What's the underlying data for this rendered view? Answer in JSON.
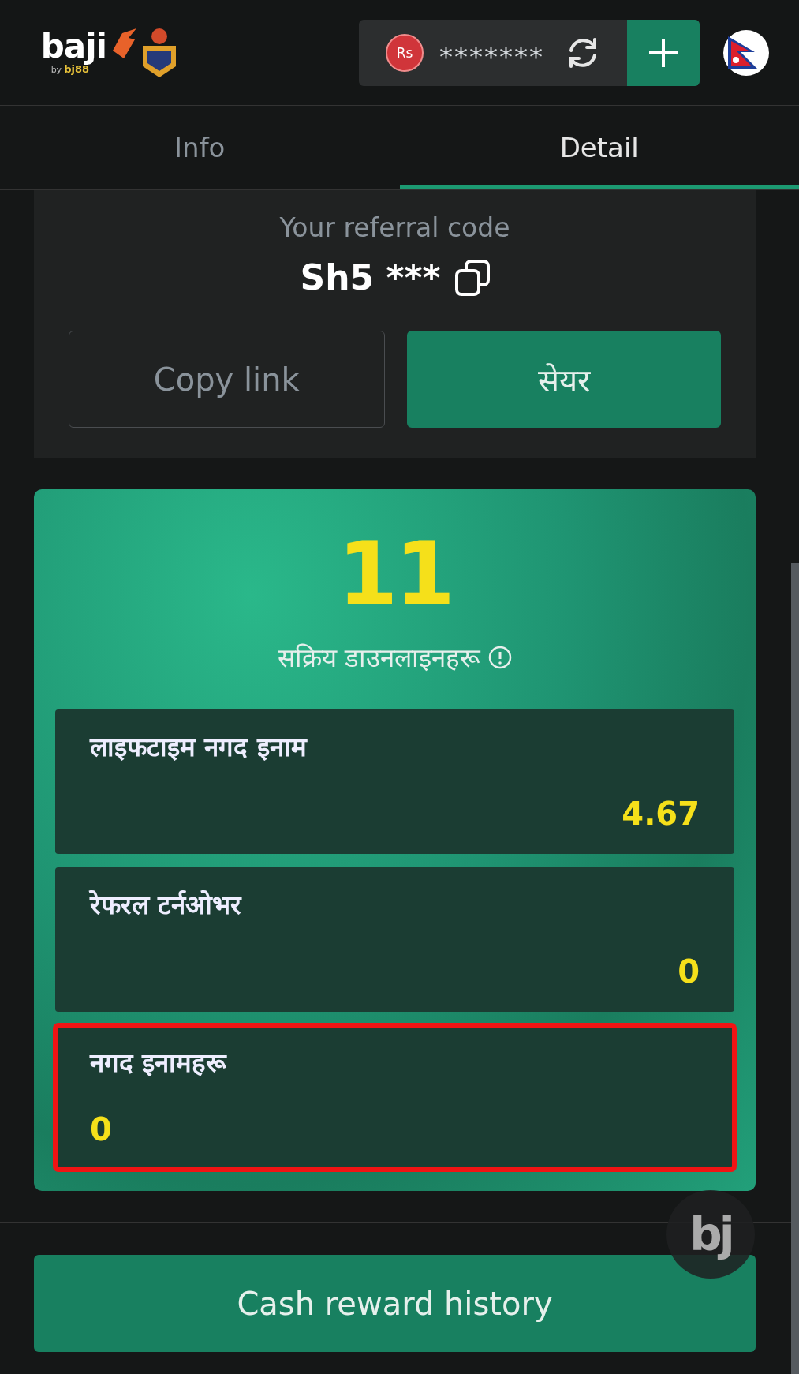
{
  "header": {
    "logo": {
      "name": "baji",
      "tagline_prefix": "by",
      "tagline_brand": "bj88"
    },
    "balance": {
      "currency": "Rs",
      "amount": "*******"
    }
  },
  "tabs": [
    {
      "label": "Info",
      "selected": false
    },
    {
      "label": "Detail",
      "selected": true
    }
  ],
  "referral": {
    "title": "Your referral code",
    "code": "Sh5",
    "masked": "***",
    "buttons": [
      {
        "label": "Copy link",
        "kind": "outline"
      },
      {
        "label": "सेयर",
        "kind": "primary"
      }
    ]
  },
  "summary": {
    "count": "11",
    "label": "सक्रिय डाउनलाइनहरू",
    "stats": [
      {
        "label": "लाइफटाइम नगद इनाम",
        "value": "4.67",
        "kind": "spread",
        "highlighted": false
      },
      {
        "label": "रेफरल टर्नओभर",
        "value": "0",
        "kind": "spread",
        "highlighted": false
      },
      {
        "label": "नगद इनामहरू",
        "value": "0",
        "kind": "stacked",
        "highlighted": true
      }
    ]
  },
  "floating_badge": "bj",
  "history_button": "Cash reward history"
}
